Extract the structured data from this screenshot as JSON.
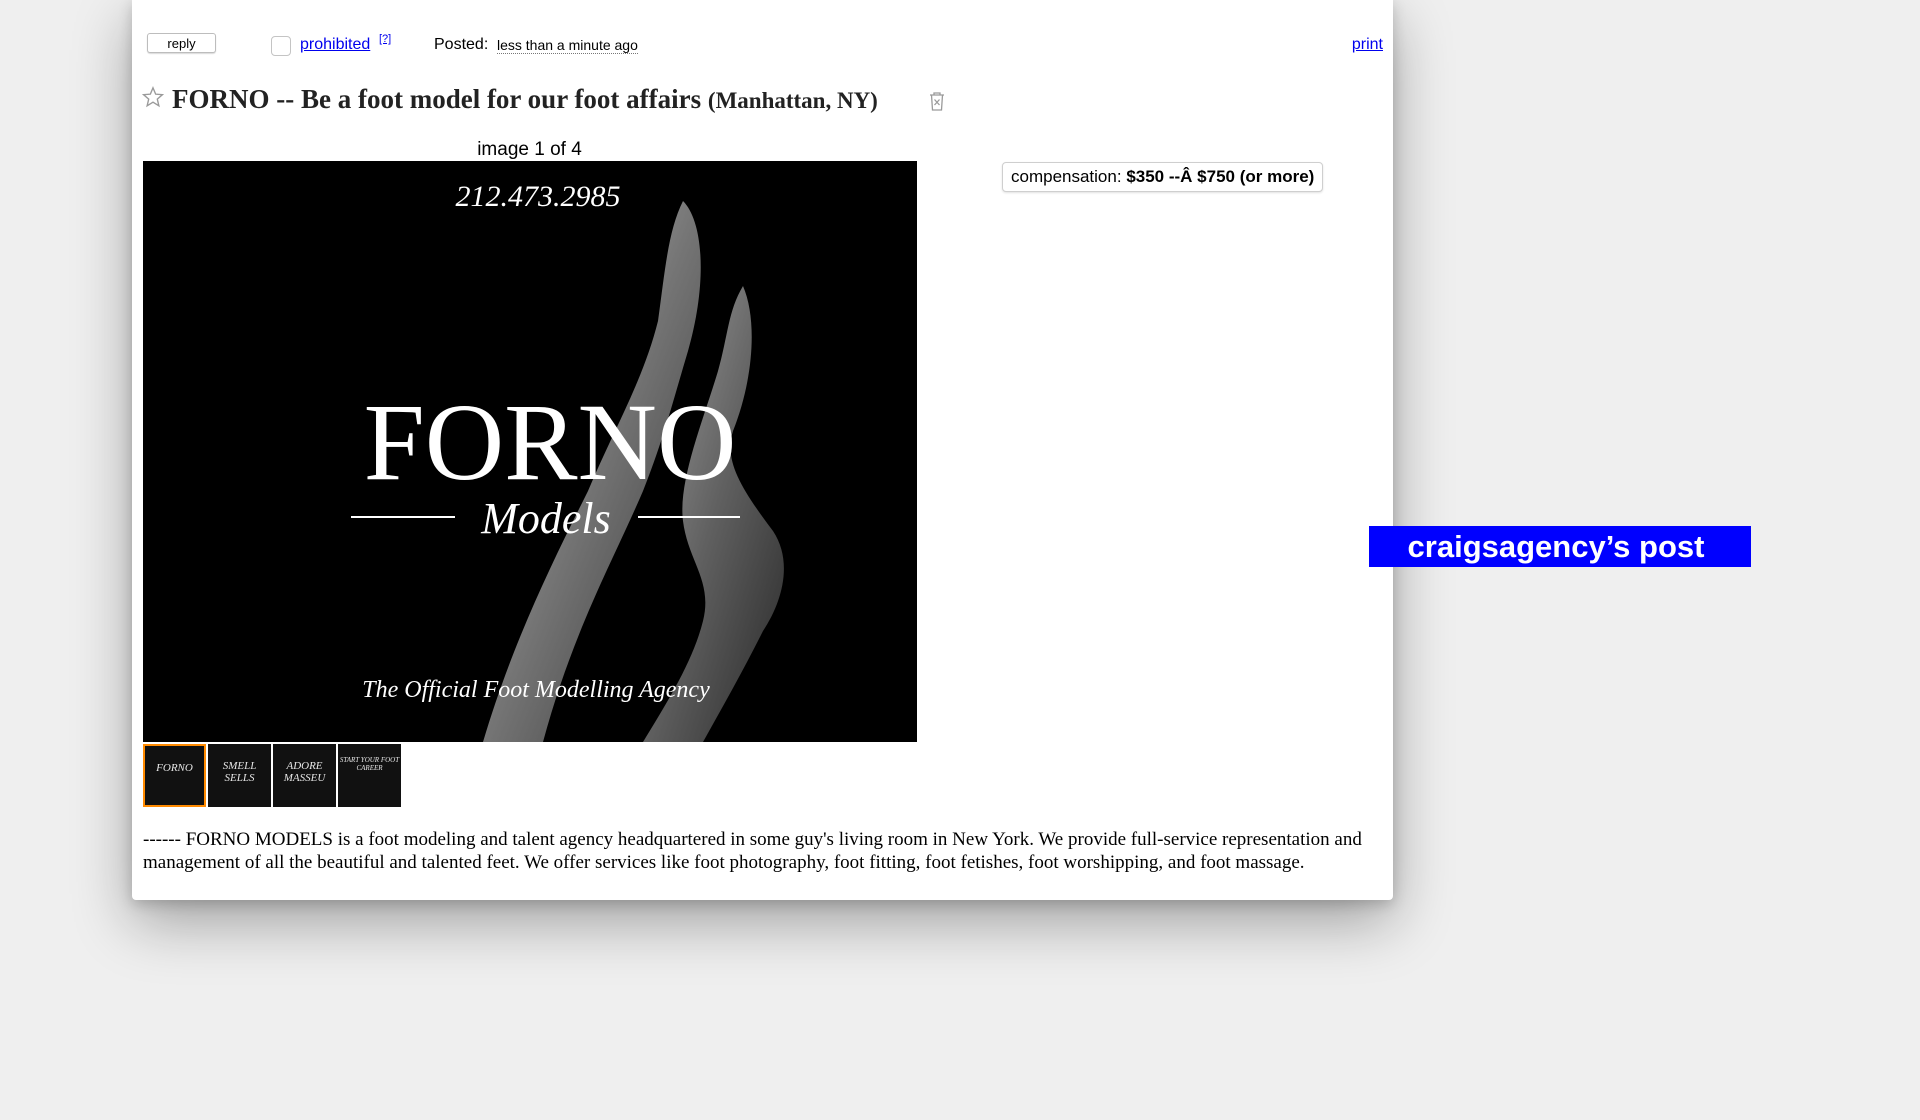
{
  "toolbar": {
    "reply_label": "reply",
    "flag_label": "prohibited",
    "help_label": "[?]",
    "posted_label": "Posted:",
    "posted_time": "less than a minute ago",
    "print_label": "print"
  },
  "posting": {
    "title": "FORNO -- Be a foot model for our foot affairs",
    "location": "(Manhattan, NY)",
    "image_count": "image 1 of 4",
    "compensation_label": "compensation:",
    "compensation_value": "$350 --Â $750 (or more)",
    "body": "------ FORNO MODELS is a foot modeling and talent agency headquartered in some guy's living room in New York. We provide full-service representation and management of all the beautiful and talented feet. We offer services like foot photography, foot fitting, foot fetishes, foot worshipping, and foot massage."
  },
  "main_image": {
    "phone": "212.473.2985",
    "brand": "FORNO",
    "subbrand": "Models",
    "tagline": "The Official Foot Modelling Agency"
  },
  "thumbnails": [
    {
      "text": "FORNO",
      "selected": true
    },
    {
      "text": "SMELL SELLS",
      "selected": false
    },
    {
      "text": "ADORE MASSEU",
      "selected": false
    },
    {
      "text": "START YOUR FOOT CAREER",
      "selected": false
    }
  ],
  "banner": {
    "text": "craigsagency’s post",
    "color": "#0000ff"
  },
  "colors": {
    "link": "#0000ee",
    "thumb_selected": "#ff8a00",
    "page_background": "#efefef"
  }
}
